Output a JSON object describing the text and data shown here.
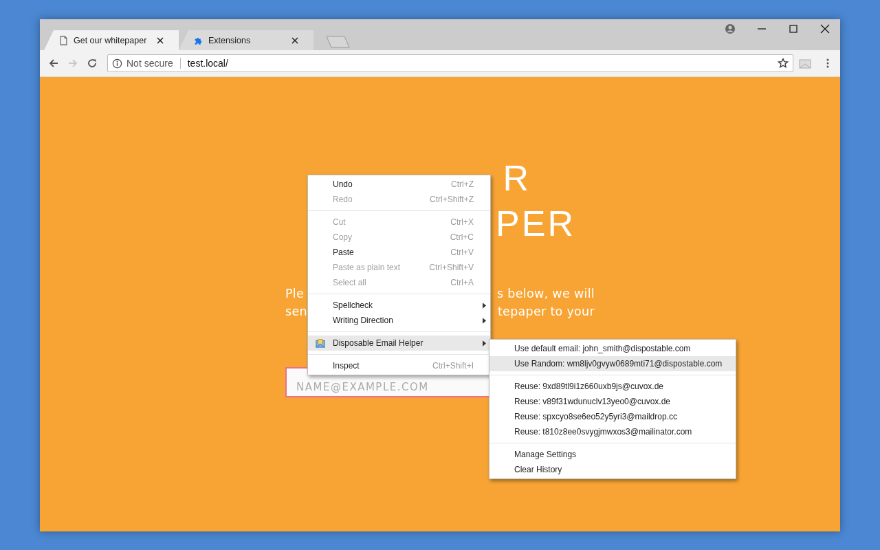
{
  "window": {
    "tabs": [
      {
        "title": "Get our whitepaper",
        "kind": "page",
        "selected": true
      },
      {
        "title": "Extensions",
        "kind": "extension",
        "selected": false
      }
    ]
  },
  "toolbar": {
    "forward_disabled": true,
    "security": "Not secure",
    "url": "test.local/"
  },
  "page": {
    "heading_top": "R",
    "heading_right": "PER",
    "paragraph": [
      {
        "left": "Ple",
        "right": "s below, we will"
      },
      {
        "left": "sen",
        "right": "tepaper to your"
      }
    ],
    "email_placeholder": "NAME@EXAMPLE.COM"
  },
  "context_menu": {
    "items": [
      {
        "kind": "item",
        "label": "Undo",
        "shortcut": "Ctrl+Z",
        "disabled": false,
        "selected": false
      },
      {
        "kind": "item",
        "label": "Redo",
        "shortcut": "Ctrl+Shift+Z",
        "disabled": true,
        "selected": false
      },
      {
        "kind": "separator"
      },
      {
        "kind": "item",
        "label": "Cut",
        "shortcut": "Ctrl+X",
        "disabled": true,
        "selected": false
      },
      {
        "kind": "item",
        "label": "Copy",
        "shortcut": "Ctrl+C",
        "disabled": true,
        "selected": false
      },
      {
        "kind": "item",
        "label": "Paste",
        "shortcut": "Ctrl+V",
        "disabled": false,
        "selected": false
      },
      {
        "kind": "item",
        "label": "Paste as plain text",
        "shortcut": "Ctrl+Shift+V",
        "disabled": true,
        "selected": false
      },
      {
        "kind": "item",
        "label": "Select all",
        "shortcut": "Ctrl+A",
        "disabled": true,
        "selected": false
      },
      {
        "kind": "separator"
      },
      {
        "kind": "submenu",
        "label": "Spellcheck",
        "disabled": false,
        "selected": false
      },
      {
        "kind": "submenu",
        "label": "Writing Direction",
        "disabled": false,
        "selected": false
      },
      {
        "kind": "separator"
      },
      {
        "kind": "submenu",
        "label": "Disposable Email Helper",
        "has_icon": true,
        "disabled": false,
        "selected": true
      },
      {
        "kind": "separator"
      },
      {
        "kind": "item",
        "label": "Inspect",
        "shortcut": "Ctrl+Shift+I",
        "disabled": false,
        "selected": false
      }
    ]
  },
  "submenu": {
    "items": [
      {
        "kind": "item",
        "label": "Use default email: john_smith@dispostable.com",
        "selected": false
      },
      {
        "kind": "item",
        "label": "Use Random: wm8ljv0gvyw0689mti71@dispostable.com",
        "selected": true
      },
      {
        "kind": "separator"
      },
      {
        "kind": "item",
        "label": "Reuse: 9xd89tl9i1z660uxb9js@cuvox.de",
        "selected": false
      },
      {
        "kind": "item",
        "label": "Reuse: v89f31wdunuclv13yeo0@cuvox.de",
        "selected": false
      },
      {
        "kind": "item",
        "label": "Reuse: spxcyo8se6eo52y5yri3@maildrop.cc",
        "selected": false
      },
      {
        "kind": "item",
        "label": "Reuse: t810z8ee0svygjmwxos3@mailinator.com",
        "selected": false
      },
      {
        "kind": "separator"
      },
      {
        "kind": "item",
        "label": "Manage Settings",
        "selected": false
      },
      {
        "kind": "item",
        "label": "Clear History",
        "selected": false
      }
    ]
  }
}
